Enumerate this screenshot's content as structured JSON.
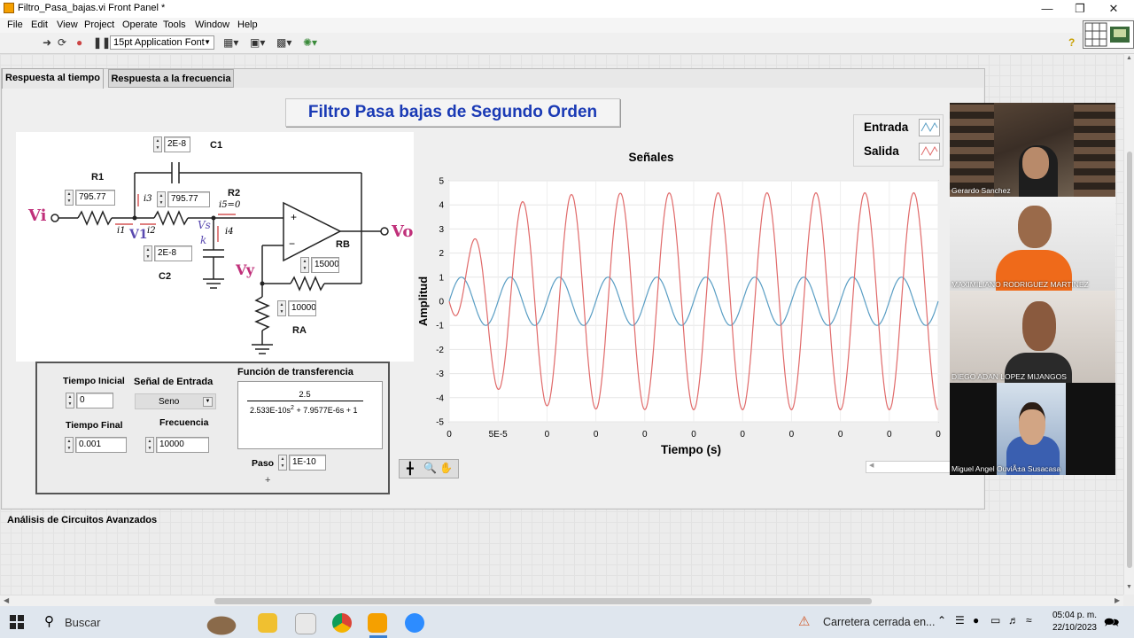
{
  "window": {
    "title": "Filtro_Pasa_bajas.vi Front Panel *",
    "min_glyph": "—",
    "max_glyph": "❐",
    "close_glyph": "✕"
  },
  "menu": [
    "File",
    "Edit",
    "View",
    "Project",
    "Operate",
    "Tools",
    "Window",
    "Help"
  ],
  "toolbar": {
    "font": "15pt Application Font",
    "help_glyph": "?"
  },
  "tabs": [
    {
      "label": "Respuesta al tiempo"
    },
    {
      "label": "Respuesta a la frecuencia"
    }
  ],
  "panel_title": "Filtro Pasa bajas de Segundo Orden",
  "circuit": {
    "c1": {
      "label": "C1",
      "value": "2E-8"
    },
    "r1": {
      "label": "R1",
      "value": "795.77"
    },
    "r2": {
      "label": "R2",
      "value": "795.77"
    },
    "c2": {
      "label": "C2",
      "value": "2E-8"
    },
    "rb": {
      "label": "RB",
      "value": "15000"
    },
    "ra": {
      "label": "RA",
      "value": "10000"
    },
    "text": {
      "vi": "Vi",
      "vo": "Vo",
      "vy": "Vy",
      "v1": "V1",
      "vs": "Vs",
      "k": "k",
      "i1": "i1",
      "i2": "i2",
      "i3": "i3",
      "i4": "i4",
      "i5": "i5=0",
      "plus": "+",
      "minus": "−"
    }
  },
  "controls": {
    "t0_label": "Tiempo Inicial",
    "t0": "0",
    "tf_label": "Tiempo Final",
    "tf": "0.001",
    "signal_label": "Señal de Entrada",
    "signal": "Seno",
    "freq_label": "Frecuencia",
    "freq": "10000",
    "tf_title": "Función de transferencia",
    "tf_num": "2.5",
    "tf_den_a": "2.533E-10s",
    "tf_den_exp": "2",
    "tf_den_b": " + 7.9577E-6s + 1",
    "step_label": "Paso",
    "step": "1E-10"
  },
  "legend": [
    {
      "name": "Entrada",
      "color": "#5a9ec4"
    },
    {
      "name": "Salida",
      "color": "#e06a6a"
    }
  ],
  "chart_data": {
    "type": "line",
    "title": "Señales",
    "xlabel": "Tiempo (s)",
    "ylabel": "Amplitud",
    "ylim": [
      -5,
      5
    ],
    "yticks": [
      "5",
      "4",
      "3",
      "2",
      "1",
      "0",
      "-1",
      "-2",
      "-3",
      "-4",
      "-5"
    ],
    "xticks": [
      "0",
      "5E-5",
      "0",
      "0",
      "0",
      "0",
      "0",
      "0",
      "0",
      "0",
      "0"
    ],
    "xlim": [
      0,
      0.001
    ],
    "series": [
      {
        "name": "Entrada",
        "color": "#5a9ec4",
        "amplitude": 1,
        "frequency": 10000
      },
      {
        "name": "Salida",
        "color": "#e06a6a",
        "amplitude": 4.5,
        "frequency": 10000
      }
    ]
  },
  "footer_label": "Análisis de Circuitos Avanzados",
  "participants": [
    {
      "name": "Gerardo Sanchez"
    },
    {
      "name": "MAXIMILIANO RODRIGUEZ MARTINEZ"
    },
    {
      "name": "DIEGO ADAN LOPEZ MIJANGOS"
    },
    {
      "name": "Miguel Angel OuviÃ±a Susacasa"
    }
  ],
  "taskbar": {
    "search": "Buscar",
    "notification": "Carretera cerrada en...",
    "time": "05:04 p. m.",
    "date": "22/10/2023"
  }
}
